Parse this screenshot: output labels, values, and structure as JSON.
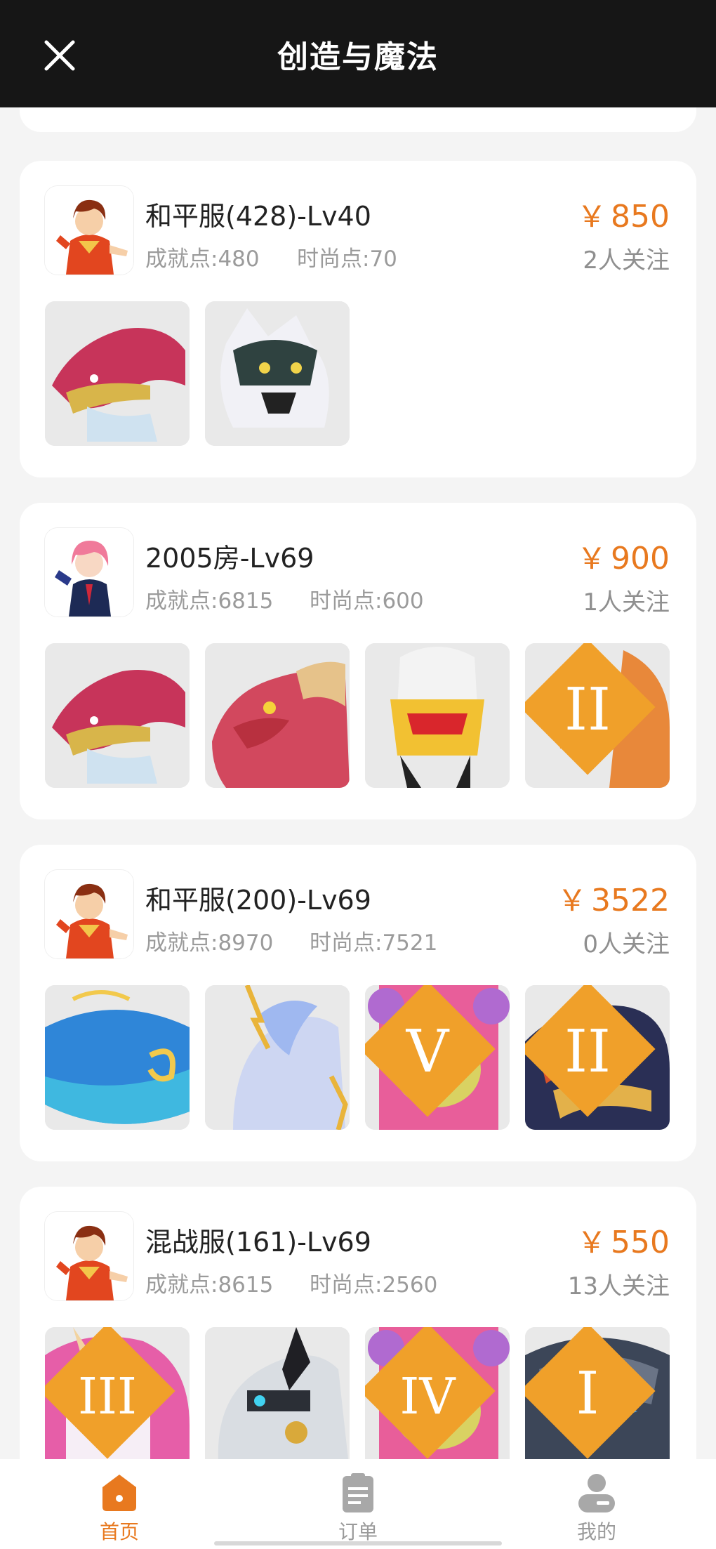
{
  "header": {
    "title": "创造与魔法"
  },
  "colors": {
    "accent": "#e8791f",
    "header_bg": "#161616",
    "page_bg": "#f4f4f4"
  },
  "listings": [
    {
      "name": "和平服(428)-Lv40",
      "achievement": "成就点:480",
      "fashion": "时尚点:70",
      "currency": "￥",
      "price": "850",
      "followers": "2人关注",
      "avatar": "red-hair-boy-avatar",
      "items": [
        "red-dragon-mount",
        "white-wolf-mount"
      ]
    },
    {
      "name": "2005房-Lv69",
      "achievement": "成就点:6815",
      "fashion": "时尚点:600",
      "currency": "￥",
      "price": "900",
      "followers": "1人关注",
      "avatar": "pink-hair-girl-avatar",
      "items": [
        "red-dragon-mount",
        "pink-dragon-mount",
        "golden-armor-mount",
        "phoenix-bird-mount-tier-II"
      ]
    },
    {
      "name": "和平服(200)-Lv69",
      "achievement": "成就点:8970",
      "fashion": "时尚点:7521",
      "currency": "￥",
      "price": "3522",
      "followers": "0人关注",
      "avatar": "red-hair-boy-avatar",
      "items": [
        "blue-whale-mount",
        "ice-horse-mount",
        "pink-bear-mount-tier-V",
        "dark-dragon-mount-tier-II"
      ]
    },
    {
      "name": "混战服(161)-Lv69",
      "achievement": "成就点:8615",
      "fashion": "时尚点:2560",
      "currency": "￥",
      "price": "550",
      "followers": "13人关注",
      "avatar": "red-hair-boy-avatar",
      "items": [
        "unicorn-mount-tier-III",
        "mech-dragon-mount",
        "pink-bear-mount-tier-IV",
        "stone-golem-mount-tier-I"
      ]
    }
  ],
  "tiers": {
    "c1i3": "II",
    "c2i2": "V",
    "c2i3": "II",
    "c3i0": "III",
    "c3i2": "IV",
    "c3i3": "I"
  },
  "tabbar": {
    "home": "首页",
    "orders": "订单",
    "mine": "我的"
  }
}
